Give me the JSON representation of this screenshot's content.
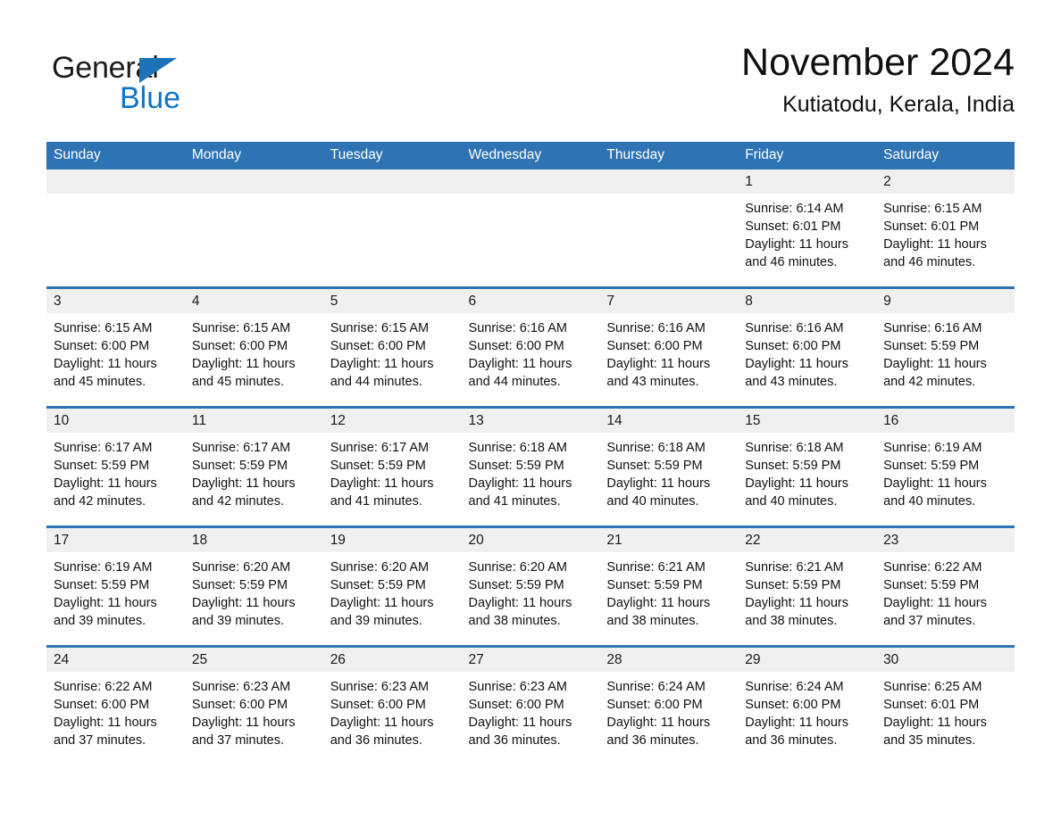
{
  "brand": {
    "name_part1": "General",
    "name_part2": "Blue",
    "triangle_color": "#1e72b8",
    "blue_color": "#1274c4"
  },
  "header": {
    "title": "November 2024",
    "subtitle": "Kutiatodu, Kerala, India"
  },
  "theme": {
    "header_blue": "#2e73b4",
    "daynum_background": "#f0f0f0",
    "page_background": "#ffffff"
  },
  "weekday_headers": [
    "Sunday",
    "Monday",
    "Tuesday",
    "Wednesday",
    "Thursday",
    "Friday",
    "Saturday"
  ],
  "labels": {
    "sunrise_prefix": "Sunrise:",
    "sunset_prefix": "Sunset:",
    "daylight_prefix": "Daylight:"
  },
  "weeks": [
    [
      {
        "day": "",
        "sunrise": "",
        "sunset": "",
        "daylight": "",
        "empty": true
      },
      {
        "day": "",
        "sunrise": "",
        "sunset": "",
        "daylight": "",
        "empty": true
      },
      {
        "day": "",
        "sunrise": "",
        "sunset": "",
        "daylight": "",
        "empty": true
      },
      {
        "day": "",
        "sunrise": "",
        "sunset": "",
        "daylight": "",
        "empty": true
      },
      {
        "day": "",
        "sunrise": "",
        "sunset": "",
        "daylight": "",
        "empty": true
      },
      {
        "day": "1",
        "sunrise": "Sunrise: 6:14 AM",
        "sunset": "Sunset: 6:01 PM",
        "daylight": "Daylight: 11 hours and 46 minutes.",
        "empty": false
      },
      {
        "day": "2",
        "sunrise": "Sunrise: 6:15 AM",
        "sunset": "Sunset: 6:01 PM",
        "daylight": "Daylight: 11 hours and 46 minutes.",
        "empty": false
      }
    ],
    [
      {
        "day": "3",
        "sunrise": "Sunrise: 6:15 AM",
        "sunset": "Sunset: 6:00 PM",
        "daylight": "Daylight: 11 hours and 45 minutes.",
        "empty": false
      },
      {
        "day": "4",
        "sunrise": "Sunrise: 6:15 AM",
        "sunset": "Sunset: 6:00 PM",
        "daylight": "Daylight: 11 hours and 45 minutes.",
        "empty": false
      },
      {
        "day": "5",
        "sunrise": "Sunrise: 6:15 AM",
        "sunset": "Sunset: 6:00 PM",
        "daylight": "Daylight: 11 hours and 44 minutes.",
        "empty": false
      },
      {
        "day": "6",
        "sunrise": "Sunrise: 6:16 AM",
        "sunset": "Sunset: 6:00 PM",
        "daylight": "Daylight: 11 hours and 44 minutes.",
        "empty": false
      },
      {
        "day": "7",
        "sunrise": "Sunrise: 6:16 AM",
        "sunset": "Sunset: 6:00 PM",
        "daylight": "Daylight: 11 hours and 43 minutes.",
        "empty": false
      },
      {
        "day": "8",
        "sunrise": "Sunrise: 6:16 AM",
        "sunset": "Sunset: 6:00 PM",
        "daylight": "Daylight: 11 hours and 43 minutes.",
        "empty": false
      },
      {
        "day": "9",
        "sunrise": "Sunrise: 6:16 AM",
        "sunset": "Sunset: 5:59 PM",
        "daylight": "Daylight: 11 hours and 42 minutes.",
        "empty": false
      }
    ],
    [
      {
        "day": "10",
        "sunrise": "Sunrise: 6:17 AM",
        "sunset": "Sunset: 5:59 PM",
        "daylight": "Daylight: 11 hours and 42 minutes.",
        "empty": false
      },
      {
        "day": "11",
        "sunrise": "Sunrise: 6:17 AM",
        "sunset": "Sunset: 5:59 PM",
        "daylight": "Daylight: 11 hours and 42 minutes.",
        "empty": false
      },
      {
        "day": "12",
        "sunrise": "Sunrise: 6:17 AM",
        "sunset": "Sunset: 5:59 PM",
        "daylight": "Daylight: 11 hours and 41 minutes.",
        "empty": false
      },
      {
        "day": "13",
        "sunrise": "Sunrise: 6:18 AM",
        "sunset": "Sunset: 5:59 PM",
        "daylight": "Daylight: 11 hours and 41 minutes.",
        "empty": false
      },
      {
        "day": "14",
        "sunrise": "Sunrise: 6:18 AM",
        "sunset": "Sunset: 5:59 PM",
        "daylight": "Daylight: 11 hours and 40 minutes.",
        "empty": false
      },
      {
        "day": "15",
        "sunrise": "Sunrise: 6:18 AM",
        "sunset": "Sunset: 5:59 PM",
        "daylight": "Daylight: 11 hours and 40 minutes.",
        "empty": false
      },
      {
        "day": "16",
        "sunrise": "Sunrise: 6:19 AM",
        "sunset": "Sunset: 5:59 PM",
        "daylight": "Daylight: 11 hours and 40 minutes.",
        "empty": false
      }
    ],
    [
      {
        "day": "17",
        "sunrise": "Sunrise: 6:19 AM",
        "sunset": "Sunset: 5:59 PM",
        "daylight": "Daylight: 11 hours and 39 minutes.",
        "empty": false
      },
      {
        "day": "18",
        "sunrise": "Sunrise: 6:20 AM",
        "sunset": "Sunset: 5:59 PM",
        "daylight": "Daylight: 11 hours and 39 minutes.",
        "empty": false
      },
      {
        "day": "19",
        "sunrise": "Sunrise: 6:20 AM",
        "sunset": "Sunset: 5:59 PM",
        "daylight": "Daylight: 11 hours and 39 minutes.",
        "empty": false
      },
      {
        "day": "20",
        "sunrise": "Sunrise: 6:20 AM",
        "sunset": "Sunset: 5:59 PM",
        "daylight": "Daylight: 11 hours and 38 minutes.",
        "empty": false
      },
      {
        "day": "21",
        "sunrise": "Sunrise: 6:21 AM",
        "sunset": "Sunset: 5:59 PM",
        "daylight": "Daylight: 11 hours and 38 minutes.",
        "empty": false
      },
      {
        "day": "22",
        "sunrise": "Sunrise: 6:21 AM",
        "sunset": "Sunset: 5:59 PM",
        "daylight": "Daylight: 11 hours and 38 minutes.",
        "empty": false
      },
      {
        "day": "23",
        "sunrise": "Sunrise: 6:22 AM",
        "sunset": "Sunset: 5:59 PM",
        "daylight": "Daylight: 11 hours and 37 minutes.",
        "empty": false
      }
    ],
    [
      {
        "day": "24",
        "sunrise": "Sunrise: 6:22 AM",
        "sunset": "Sunset: 6:00 PM",
        "daylight": "Daylight: 11 hours and 37 minutes.",
        "empty": false
      },
      {
        "day": "25",
        "sunrise": "Sunrise: 6:23 AM",
        "sunset": "Sunset: 6:00 PM",
        "daylight": "Daylight: 11 hours and 37 minutes.",
        "empty": false
      },
      {
        "day": "26",
        "sunrise": "Sunrise: 6:23 AM",
        "sunset": "Sunset: 6:00 PM",
        "daylight": "Daylight: 11 hours and 36 minutes.",
        "empty": false
      },
      {
        "day": "27",
        "sunrise": "Sunrise: 6:23 AM",
        "sunset": "Sunset: 6:00 PM",
        "daylight": "Daylight: 11 hours and 36 minutes.",
        "empty": false
      },
      {
        "day": "28",
        "sunrise": "Sunrise: 6:24 AM",
        "sunset": "Sunset: 6:00 PM",
        "daylight": "Daylight: 11 hours and 36 minutes.",
        "empty": false
      },
      {
        "day": "29",
        "sunrise": "Sunrise: 6:24 AM",
        "sunset": "Sunset: 6:00 PM",
        "daylight": "Daylight: 11 hours and 36 minutes.",
        "empty": false
      },
      {
        "day": "30",
        "sunrise": "Sunrise: 6:25 AM",
        "sunset": "Sunset: 6:01 PM",
        "daylight": "Daylight: 11 hours and 35 minutes.",
        "empty": false
      }
    ]
  ]
}
